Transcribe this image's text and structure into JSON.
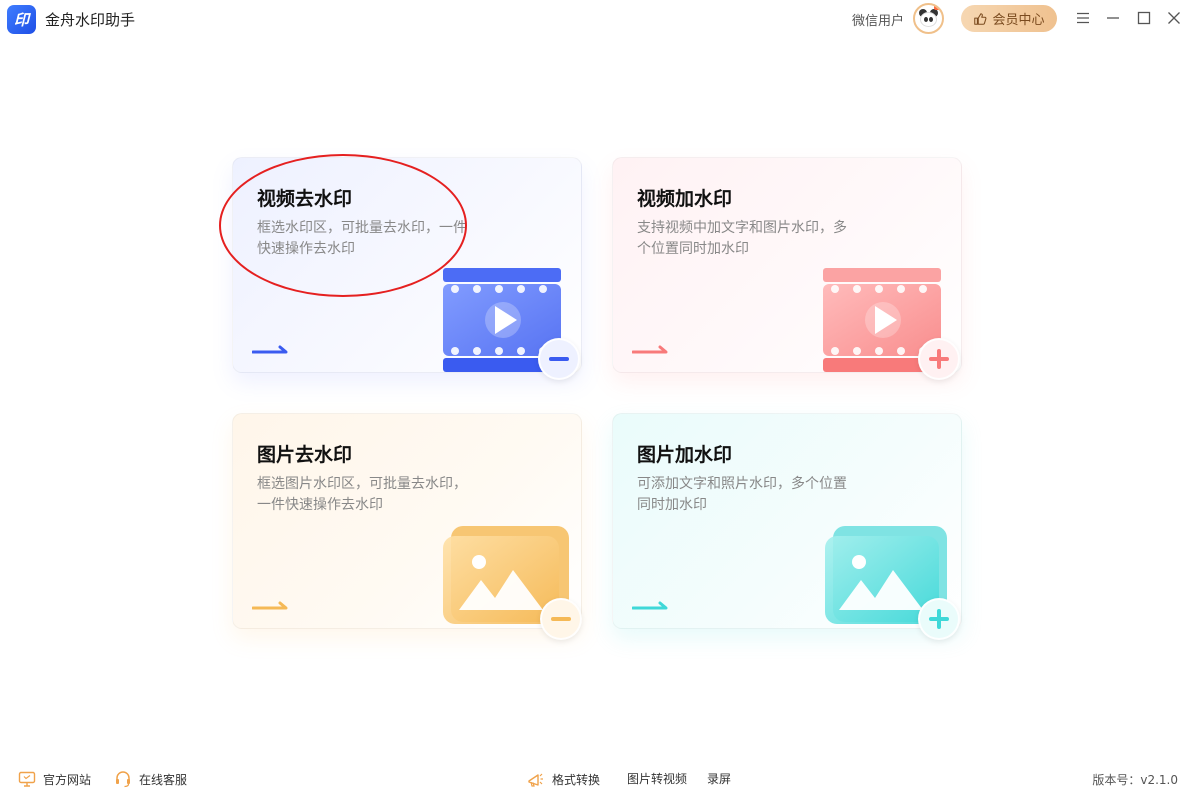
{
  "app": {
    "title": "金舟水印助手",
    "logo_text": "印"
  },
  "user": {
    "name": "微信用户"
  },
  "vip": {
    "label": "会员中心"
  },
  "cards": [
    {
      "title": "视频去水印",
      "desc": "框选水印区，可批量去水印，一件快速操作去水印",
      "accent": "#3a5bf0",
      "icon": "film-minus-icon"
    },
    {
      "title": "视频加水印",
      "desc": "支持视频中加文字和图片水印，多个位置同时加水印",
      "accent": "#f87a7a",
      "icon": "film-plus-icon"
    },
    {
      "title": "图片去水印",
      "desc": "框选图片水印区，可批量去水印，一件快速操作去水印",
      "accent": "#f5b956",
      "icon": "image-minus-icon"
    },
    {
      "title": "图片加水印",
      "desc": "可添加文字和照片水印，多个位置同时加水印",
      "accent": "#3fd8d8",
      "icon": "image-plus-icon"
    }
  ],
  "bottom": {
    "website": "官方网站",
    "service": "在线客服",
    "format_convert": "格式转换",
    "img_to_video": "图片转视频",
    "record": "录屏",
    "version": "版本号：v2.1.0"
  }
}
